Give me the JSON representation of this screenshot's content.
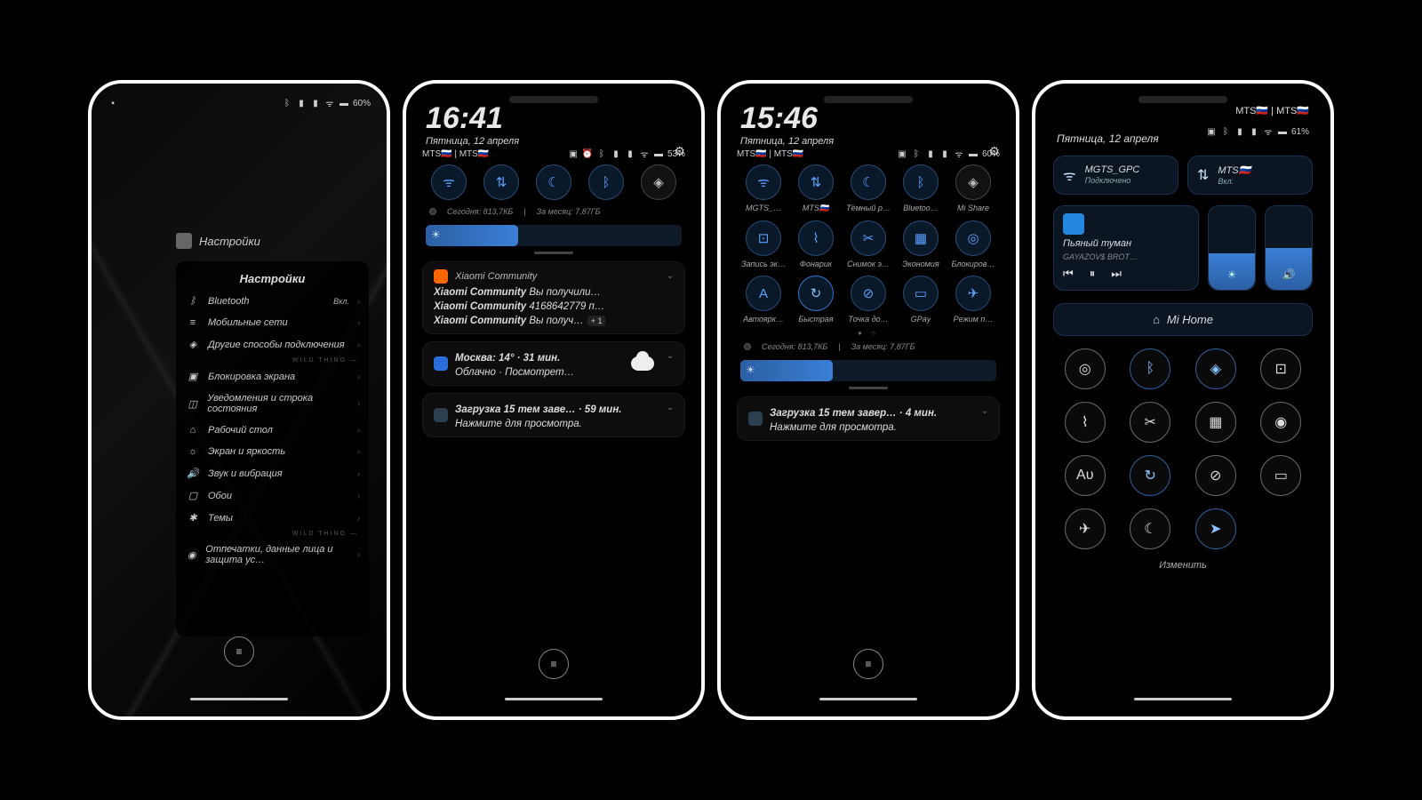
{
  "status": {
    "battery1": "60%",
    "battery2": "53%",
    "battery3": "60%",
    "battery4": "61%"
  },
  "carrier": "MTS🇷🇺 | MTS🇷🇺",
  "settings": {
    "app": "Настройки",
    "title": "Настройки",
    "items": [
      {
        "ic": "ᛒ",
        "label": "Bluetooth",
        "sub": "Вкл."
      },
      {
        "ic": "≡",
        "label": "Мобильные сети"
      },
      {
        "ic": "◈",
        "label": "Другие способы подключения"
      },
      {
        "divider": "WILD THING —"
      },
      {
        "ic": "▣",
        "label": "Блокировка экрана"
      },
      {
        "ic": "◫",
        "label": "Уведомления и строка состояния"
      },
      {
        "ic": "⌂",
        "label": "Рабочий стол"
      },
      {
        "ic": "☼",
        "label": "Экран и яркость"
      },
      {
        "ic": "🔊",
        "label": "Звук и вибрация"
      },
      {
        "ic": "▢",
        "label": "Обои"
      },
      {
        "ic": "✱",
        "label": "Темы"
      },
      {
        "divider": "WILD THING —"
      },
      {
        "ic": "◉",
        "label": "Отпечатки, данные лица и защита ус…"
      }
    ]
  },
  "shade2": {
    "time": "16:41",
    "date": "Пятница, 12 апреля",
    "qs": [
      {
        "ic": "ᯤ"
      },
      {
        "ic": "⇅"
      },
      {
        "ic": "☾"
      },
      {
        "ic": "ᛒ"
      },
      {
        "ic": "◈",
        "dim": true
      }
    ],
    "usage": {
      "today": "Сегодня: 813,7КБ",
      "month": "За месяц: 7,87ГБ"
    },
    "notifs": [
      {
        "app": "Xiaomi Community",
        "icon": "or",
        "lines": [
          "Xiaomi Community Вы получили…",
          "Xiaomi Community 4168642779 п…",
          "Xiaomi Community Вы получ…"
        ],
        "more": "+ 1"
      },
      {
        "app": "weather",
        "icon": "bl",
        "title": "Москва: 14° · 31 мин.",
        "sub": "Облачно · Посмотрет…"
      },
      {
        "app": "themes",
        "icon": "dk",
        "title": "Загрузка 15 тем заве…  · 59 мин.",
        "sub": "Нажмите для просмотра."
      }
    ]
  },
  "shade3": {
    "time": "15:46",
    "date": "Пятница, 12 апреля",
    "qs1": [
      {
        "ic": "ᯤ",
        "lbl": "MGTS_…"
      },
      {
        "ic": "⇅",
        "lbl": "MTS🇷🇺"
      },
      {
        "ic": "☾",
        "lbl": "Тёмный р…"
      },
      {
        "ic": "ᛒ",
        "lbl": "Bluetoo…"
      },
      {
        "ic": "◈",
        "lbl": "Mi Share",
        "dim": true
      }
    ],
    "qs2": [
      {
        "ic": "⊡",
        "lbl": "Запись эк…"
      },
      {
        "ic": "⌇",
        "lbl": "Фонарик"
      },
      {
        "ic": "✂",
        "lbl": "Снимок э…"
      },
      {
        "ic": "▦",
        "lbl": "Экономия"
      },
      {
        "ic": "◎",
        "lbl": "Блокиров…"
      }
    ],
    "qs3": [
      {
        "ic": "A",
        "lbl": "Автоярк…"
      },
      {
        "ic": "↻",
        "lbl": "Быстрая",
        "on": true
      },
      {
        "ic": "⊘",
        "lbl": "Точка до…"
      },
      {
        "ic": "▭",
        "lbl": "GPay"
      },
      {
        "ic": "✈",
        "lbl": "Режим п…"
      }
    ],
    "usage": {
      "today": "Сегодня: 813,7КБ",
      "month": "За месяц: 7,87ГБ"
    },
    "notif": {
      "title": "Загрузка 15 тем завер…  · 4 мин.",
      "sub": "Нажмите для просмотра."
    }
  },
  "cc": {
    "carriers": "MTS🇷🇺 | MTS🇷🇺",
    "date": "Пятница, 12 апреля",
    "wifi": {
      "name": "MGTS_GPC",
      "sub": "Подключено"
    },
    "data": {
      "name": "MTS🇷🇺",
      "sub": "Вкл."
    },
    "media": {
      "song": "Пьяный туман",
      "artist": "GAYAZOV$ BROT…"
    },
    "mihome": "Mi Home",
    "grid": [
      {
        "ic": "◎"
      },
      {
        "ic": "ᛒ",
        "on": true
      },
      {
        "ic": "◈",
        "on": true
      },
      {
        "ic": "⊡"
      },
      {
        "ic": "⌇"
      },
      {
        "ic": "✂"
      },
      {
        "ic": "▦"
      },
      {
        "ic": "◉"
      },
      {
        "ic": "Aᴜ"
      },
      {
        "ic": "↻",
        "on": true
      },
      {
        "ic": "⊘"
      },
      {
        "ic": "▭"
      },
      {
        "ic": "✈"
      },
      {
        "ic": "☾"
      },
      {
        "ic": "➤",
        "on": true
      }
    ],
    "edit": "Изменить"
  }
}
